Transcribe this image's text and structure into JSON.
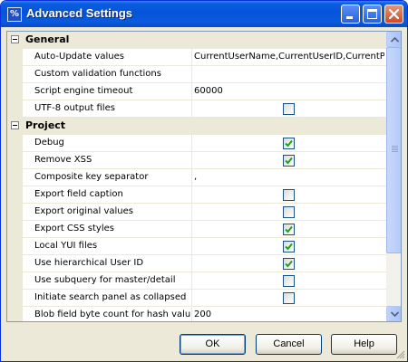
{
  "window": {
    "title": "Advanced Settings",
    "app_icon_glyph": "%"
  },
  "categories": [
    {
      "label": "General",
      "expanded": true,
      "properties": [
        {
          "name": "Auto-Update values",
          "type": "text",
          "value": "CurrentUserName,CurrentUserID,CurrentPa"
        },
        {
          "name": "Custom validation functions",
          "type": "text",
          "value": ""
        },
        {
          "name": "Script engine timeout",
          "type": "text",
          "value": "60000"
        },
        {
          "name": "UTF-8 output files",
          "type": "checkbox",
          "checked": false
        }
      ]
    },
    {
      "label": "Project",
      "expanded": true,
      "properties": [
        {
          "name": "Debug",
          "type": "checkbox",
          "checked": true
        },
        {
          "name": "Remove XSS",
          "type": "checkbox",
          "checked": true
        },
        {
          "name": "Composite key separator",
          "type": "text",
          "value": ","
        },
        {
          "name": "Export field caption",
          "type": "checkbox",
          "checked": false
        },
        {
          "name": "Export original values",
          "type": "checkbox",
          "checked": false
        },
        {
          "name": "Export CSS styles",
          "type": "checkbox",
          "checked": true
        },
        {
          "name": "Local YUI files",
          "type": "checkbox",
          "checked": true
        },
        {
          "name": "Use hierarchical User ID",
          "type": "checkbox",
          "checked": true
        },
        {
          "name": "Use subquery for master/detail",
          "type": "checkbox",
          "checked": false
        },
        {
          "name": "Initiate search panel as collapsed",
          "type": "checkbox",
          "checked": false
        },
        {
          "name": "Blob field byte count for hash value",
          "type": "text",
          "value": "200"
        }
      ]
    }
  ],
  "buttons": {
    "ok": "OK",
    "cancel": "Cancel",
    "help": "Help"
  },
  "colors": {
    "titlebar": "#0553d8",
    "check": "#21a121",
    "grid_border": "#7f9db9"
  },
  "icons": {
    "minimize": "minimize-icon",
    "maximize": "maximize-icon",
    "close": "close-icon",
    "expander": "collapse-icon"
  }
}
